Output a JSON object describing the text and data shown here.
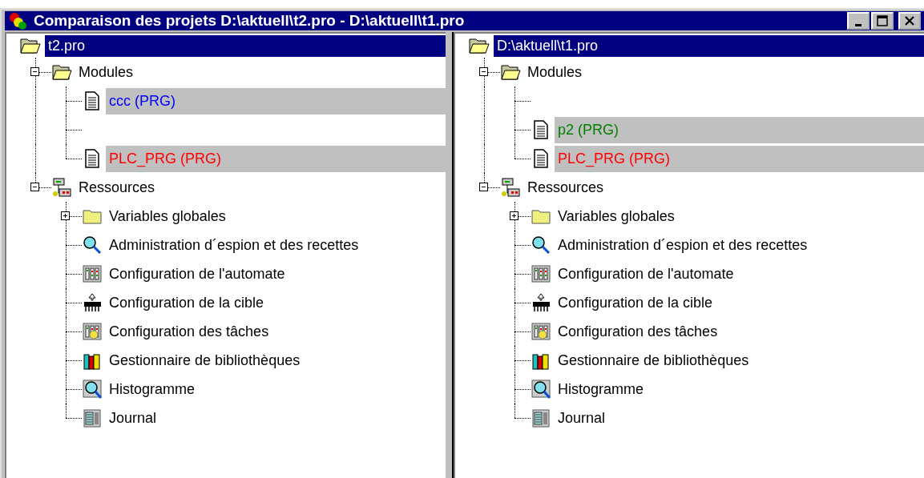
{
  "window": {
    "title": "Comparaison des projets D:\\aktuell\\t2.pro - D:\\aktuell\\t1.pro"
  },
  "panes": [
    {
      "root": {
        "label": "t2.pro",
        "selected": true
      },
      "tree": [
        {
          "kind": "folder-open",
          "label": "Modules",
          "expanded": true,
          "children": [
            {
              "kind": "document",
              "label": "ccc (PRG)",
              "color": "#0000ff",
              "highlighted": true
            },
            {
              "kind": "gap"
            },
            {
              "kind": "document",
              "label": "PLC_PRG (PRG)",
              "color": "#ff0000",
              "highlighted": true
            }
          ]
        },
        {
          "kind": "resources",
          "label": "Ressources",
          "expanded": true,
          "children": [
            {
              "kind": "folder",
              "label": "Variables globales",
              "expanded": false
            },
            {
              "kind": "magnifier",
              "label": "Administration d´espion et des recettes"
            },
            {
              "kind": "plc",
              "label": "Configuration de l'automate"
            },
            {
              "kind": "chip",
              "label": "Configuration de la cible"
            },
            {
              "kind": "tasks",
              "label": "Configuration des tâches"
            },
            {
              "kind": "books",
              "label": "Gestionnaire de bibliothèques"
            },
            {
              "kind": "trace",
              "label": "Histogramme"
            },
            {
              "kind": "journal",
              "label": "Journal"
            }
          ]
        }
      ]
    },
    {
      "root": {
        "label": "D:\\aktuell\\t1.pro",
        "selected": true
      },
      "tree": [
        {
          "kind": "folder-open",
          "label": "Modules",
          "expanded": true,
          "children": [
            {
              "kind": "gap"
            },
            {
              "kind": "document",
              "label": "p2 (PRG)",
              "color": "#008000",
              "highlighted": true
            },
            {
              "kind": "document",
              "label": "PLC_PRG (PRG)",
              "color": "#ff0000",
              "highlighted": true
            }
          ]
        },
        {
          "kind": "resources",
          "label": "Ressources",
          "expanded": true,
          "children": [
            {
              "kind": "folder",
              "label": "Variables globales",
              "expanded": false
            },
            {
              "kind": "magnifier",
              "label": "Administration d´espion et des recettes"
            },
            {
              "kind": "plc",
              "label": "Configuration de l'automate"
            },
            {
              "kind": "chip",
              "label": "Configuration de la cible"
            },
            {
              "kind": "tasks",
              "label": "Configuration des tâches"
            },
            {
              "kind": "books",
              "label": "Gestionnaire de bibliothèques"
            },
            {
              "kind": "trace",
              "label": "Histogramme"
            },
            {
              "kind": "journal",
              "label": "Journal"
            }
          ]
        }
      ]
    }
  ]
}
